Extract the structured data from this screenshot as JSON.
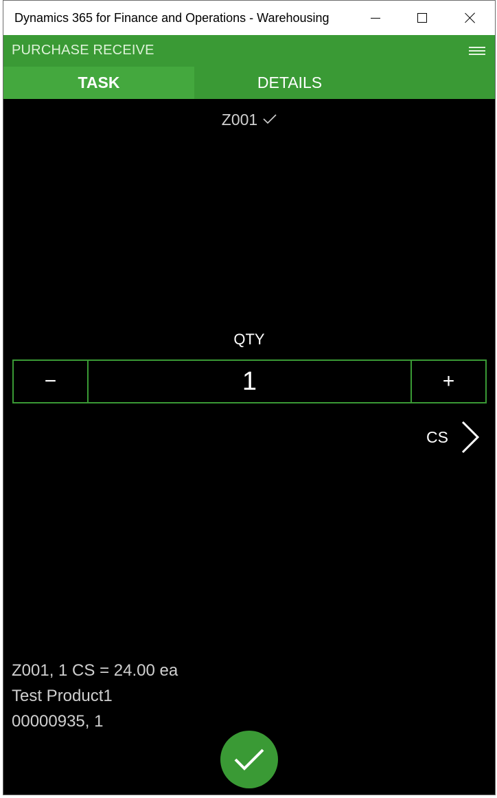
{
  "window": {
    "title": "Dynamics 365 for Finance and Operations - Warehousing",
    "controls": [
      "minimize-icon",
      "maximize-icon",
      "close-icon"
    ]
  },
  "appbar": {
    "title": "PURCHASE RECEIVE",
    "menu_icon": "hamburger-menu-icon"
  },
  "tabs": [
    {
      "label": "TASK",
      "active": true
    },
    {
      "label": "DETAILS",
      "active": false
    }
  ],
  "task": {
    "location": "Z001",
    "location_icon": "checkmark-icon",
    "qty_label": "QTY",
    "minus_label": "−",
    "plus_label": "+",
    "qty_value": "1",
    "unit": "CS",
    "unit_icon": "chevron-right-icon",
    "info_lines": [
      "Z001, 1 CS = 24.00 ea",
      "Test Product1",
      "00000935, 1"
    ],
    "confirm_icon": "checkmark-icon"
  },
  "colors": {
    "accent": "#3a9a35",
    "active_tab": "#44a83e",
    "background": "#000000"
  }
}
